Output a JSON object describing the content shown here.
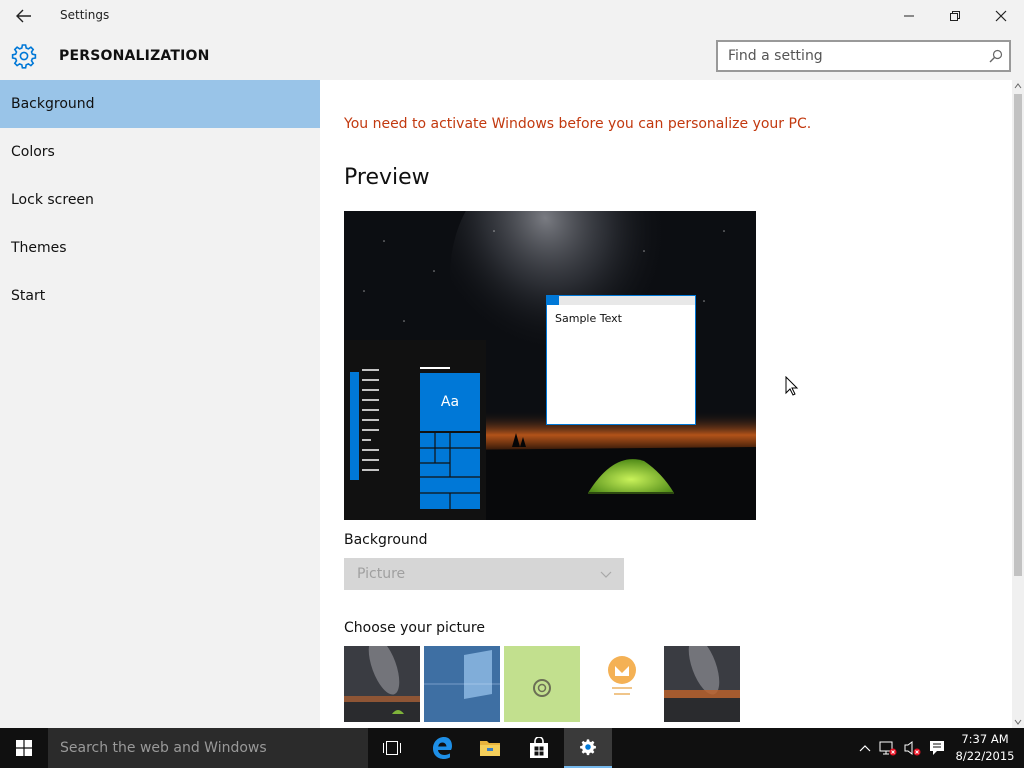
{
  "window": {
    "title": "Settings"
  },
  "header": {
    "title": "PERSONALIZATION",
    "search_placeholder": "Find a setting"
  },
  "sidebar": {
    "items": [
      {
        "label": "Background",
        "selected": true
      },
      {
        "label": "Colors",
        "selected": false
      },
      {
        "label": "Lock screen",
        "selected": false
      },
      {
        "label": "Themes",
        "selected": false
      },
      {
        "label": "Start",
        "selected": false
      }
    ]
  },
  "main": {
    "warning": "You need to activate Windows before you can personalize your PC.",
    "preview_heading": "Preview",
    "preview": {
      "tile_text": "Aa",
      "window_text": "Sample Text"
    },
    "background_label": "Background",
    "background_value": "Picture",
    "choose_label": "Choose your picture"
  },
  "taskbar": {
    "search_placeholder": "Search the web and Windows",
    "time": "7:37 AM",
    "date": "8/22/2015"
  },
  "colors": {
    "accent": "#0078d7",
    "selection": "#99c4e8",
    "warning": "#c2390f"
  }
}
